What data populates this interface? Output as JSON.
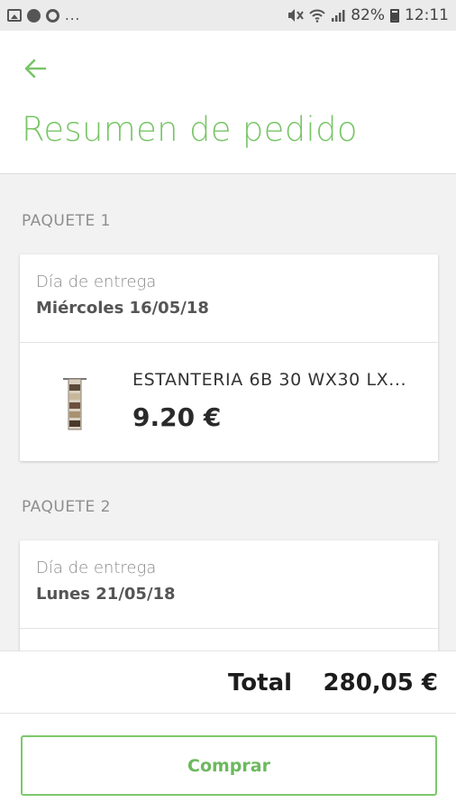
{
  "status_bar": {
    "left_icons": [
      "gallery-icon",
      "chat-icon",
      "sync-icon"
    ],
    "ellipsis": "...",
    "right_icons": [
      "mute-icon",
      "wifi-icon",
      "signal-icon"
    ],
    "battery": "82%",
    "time": "12:11"
  },
  "header": {
    "back_icon": "arrow-left-icon",
    "title": "Resumen de pedido",
    "accent_color": "#78c567"
  },
  "packages": [
    {
      "label": "PAQUETE 1",
      "delivery_label": "Día de entrega",
      "delivery_date": "Miércoles 16/05/18",
      "item": {
        "name": "ESTANTERIA 6B 30 WX30 LX...",
        "price": "9.20 €",
        "thumb_icon": "shelf-product-image"
      }
    },
    {
      "label": "PAQUETE 2",
      "delivery_label": "Día de entrega",
      "delivery_date": "Lunes 21/05/18"
    }
  ],
  "footer": {
    "total_label": "Total",
    "total_value": "280,05 €",
    "buy_label": "Comprar"
  }
}
